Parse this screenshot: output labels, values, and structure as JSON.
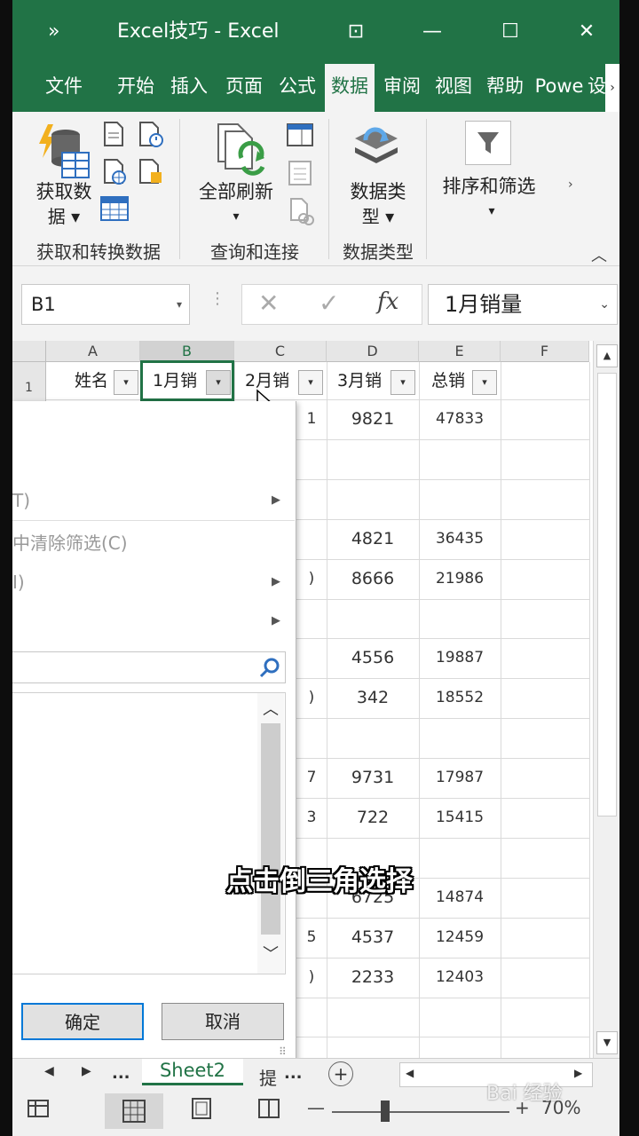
{
  "titlebar": {
    "more": "»",
    "title": "Excel技巧  -  Excel",
    "ribbon_display": "⊡",
    "minimize": "—",
    "maximize": "☐",
    "close": "✕"
  },
  "tabs": [
    "文件",
    "开始",
    "插入",
    "页面",
    "公式",
    "数据",
    "审阅",
    "视图",
    "帮助",
    "Powe",
    "设"
  ],
  "active_tab": "数据",
  "ribbon": {
    "get_data_label_1": "获取数",
    "get_data_label_2": "据 ▾",
    "refresh_all_label": "全部刷新",
    "refresh_arrow": "▾",
    "data_type_label_1": "数据类",
    "data_type_label_2": "型 ▾",
    "sort_filter_label": "排序和筛选",
    "sort_filter_arrow": "▾",
    "groups": [
      "获取和转换数据",
      "查询和连接",
      "数据类型"
    ],
    "scroll": "›",
    "collapse": "︿"
  },
  "formula_bar": {
    "name_box": "B1",
    "name_box_arrow": "▾",
    "dots": "⋮",
    "cancel": "✕",
    "enter": "✓",
    "fx": "fx",
    "content": "1月销量",
    "content_arrow": "⌄"
  },
  "sheet": {
    "columns": [
      "A",
      "B",
      "C",
      "D",
      "E",
      "F"
    ],
    "selected_column": "B",
    "row_1_label": "1",
    "headers": [
      "姓名",
      "1月销",
      "2月销",
      "3月销",
      "总销"
    ],
    "filter_arrow": "▾",
    "rows": [
      {
        "c": "1",
        "d": "9821",
        "e": "47833"
      },
      {
        "c": "",
        "d": "",
        "e": ""
      },
      {
        "c": "",
        "d": "",
        "e": ""
      },
      {
        "c": "",
        "d": "4821",
        "e": "36435"
      },
      {
        "c": ")",
        "d": "8666",
        "e": "21986"
      },
      {
        "c": "",
        "d": "",
        "e": ""
      },
      {
        "c": "",
        "d": "4556",
        "e": "19887"
      },
      {
        "c": ")",
        "d": "342",
        "e": "18552"
      },
      {
        "c": "",
        "d": "",
        "e": ""
      },
      {
        "c": "7",
        "d": "9731",
        "e": "17987"
      },
      {
        "c": "3",
        "d": "722",
        "e": "15415"
      },
      {
        "c": "",
        "d": "",
        "e": ""
      },
      {
        "c": "",
        "d": "6725",
        "e": "14874"
      },
      {
        "c": "5",
        "d": "4537",
        "e": "12459"
      },
      {
        "c": ")",
        "d": "2233",
        "e": "12403"
      },
      {
        "c": "",
        "d": "",
        "e": ""
      }
    ],
    "scroll_up": "▲",
    "scroll_down": "▼"
  },
  "filter_menu": {
    "item_1": "T)",
    "item_2": "中清除筛选(C)",
    "item_3": "I)",
    "submenu_arrow": "▶",
    "ok": "确定",
    "cancel": "取消",
    "list_up": "︿",
    "list_down": "﹀",
    "grip": "⠿"
  },
  "sheet_tabs": {
    "prev": "◀",
    "next": "▶",
    "more_left": "...",
    "active": "Sheet2",
    "next_tab": "提",
    "more_right": "...",
    "add": "+",
    "hscroll_left": "◀",
    "hscroll_right": "▶"
  },
  "status_bar": {
    "zoom_minus": "—",
    "zoom_plus": "+",
    "zoom": "70%",
    "zoom_level": 0.3
  },
  "caption": "点击倒三角选择",
  "watermark": "Bai 经验",
  "colors": {
    "excel_green": "#217346",
    "ok_border": "#0078d7"
  }
}
